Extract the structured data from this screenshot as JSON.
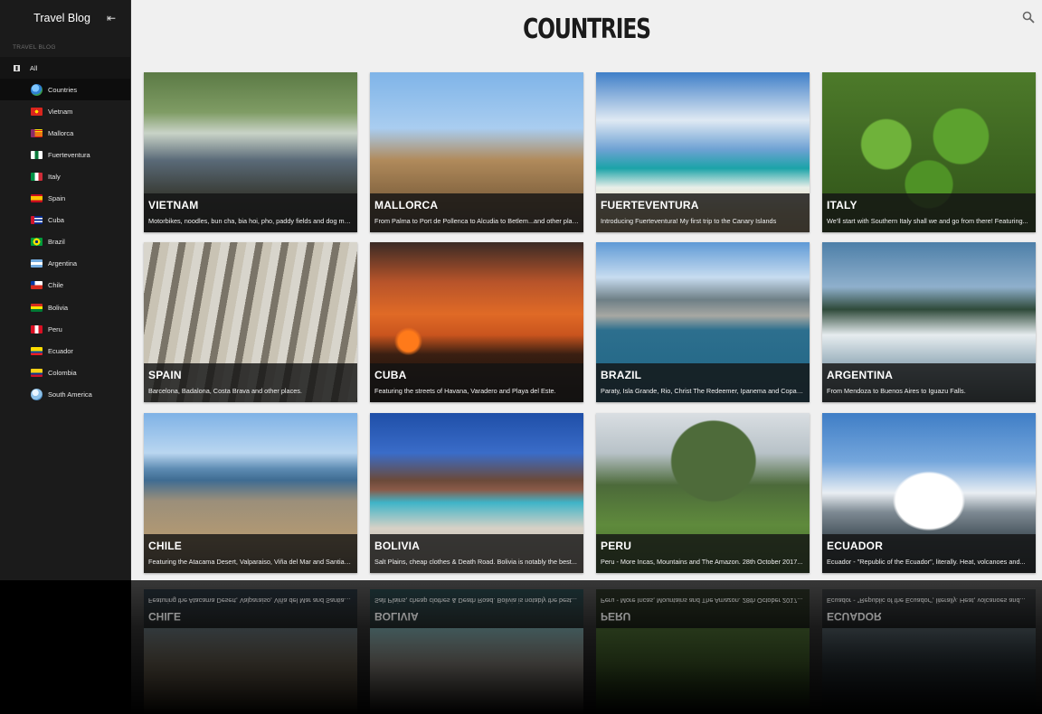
{
  "sidebar": {
    "title": "Travel Blog",
    "collapse_icon": "collapse-arrow-icon",
    "section_label": "Travel Blog",
    "all_label": "All",
    "items": [
      {
        "label": "Countries",
        "icon": "globe-icon",
        "active": true
      },
      {
        "label": "Vietnam",
        "icon": "flag-vietnam-icon"
      },
      {
        "label": "Mallorca",
        "icon": "flag-mallorca-icon"
      },
      {
        "label": "Fuerteventura",
        "icon": "flag-fuerteventura-icon"
      },
      {
        "label": "Italy",
        "icon": "flag-italy-icon"
      },
      {
        "label": "Spain",
        "icon": "flag-spain-icon"
      },
      {
        "label": "Cuba",
        "icon": "flag-cuba-icon"
      },
      {
        "label": "Brazil",
        "icon": "flag-brazil-icon"
      },
      {
        "label": "Argentina",
        "icon": "flag-argentina-icon"
      },
      {
        "label": "Chile",
        "icon": "flag-chile-icon"
      },
      {
        "label": "Bolivia",
        "icon": "flag-bolivia-icon"
      },
      {
        "label": "Peru",
        "icon": "flag-peru-icon"
      },
      {
        "label": "Ecuador",
        "icon": "flag-ecuador-icon"
      },
      {
        "label": "Colombia",
        "icon": "flag-colombia-icon"
      },
      {
        "label": "South America",
        "icon": "globe-icon"
      }
    ]
  },
  "main": {
    "title": "COUNTRIES",
    "search_icon": "search-icon",
    "cards": [
      {
        "title": "VIETNAM",
        "desc": "Motorbikes, noodles, bun cha, bia hoi, pho, paddy fields and dog meat..."
      },
      {
        "title": "MALLORCA",
        "desc": "From Palma to Port de Pollenca to Alcudia to Betlem...and other places"
      },
      {
        "title": "FUERTEVENTURA",
        "desc": "Introducing Fuerteventura! My first trip to the Canary Islands"
      },
      {
        "title": "ITALY",
        "desc": "We'll start with Southern Italy shall we and go from there! Featuring..."
      },
      {
        "title": "SPAIN",
        "desc": "Barcelona, Badalona, Costa Brava and other places."
      },
      {
        "title": "CUBA",
        "desc": "Featuring the streets of Havana, Varadero and Playa del Este."
      },
      {
        "title": "BRAZIL",
        "desc": "Paraty, Isla Grande, Rio, Christ The Redeemer, Ipanema and Copacabana..."
      },
      {
        "title": "ARGENTINA",
        "desc": "From Mendoza to Buenos Aires to Iguazu Falls."
      },
      {
        "title": "CHILE",
        "desc": "Featuring the Atacama Desert, Valparaiso, Viña del Mar and Santiago..."
      },
      {
        "title": "BOLIVIA",
        "desc": "Salt Plains, cheap clothes & Death Road. Bolivia is notably the best..."
      },
      {
        "title": "PERU",
        "desc": "Peru - More Incas, Mountains and The Amazon. 28th October 2017..."
      },
      {
        "title": "ECUADOR",
        "desc": "Ecuador - \"Republic of the Ecuador\", literally. Heat, volcanoes and..."
      }
    ]
  }
}
